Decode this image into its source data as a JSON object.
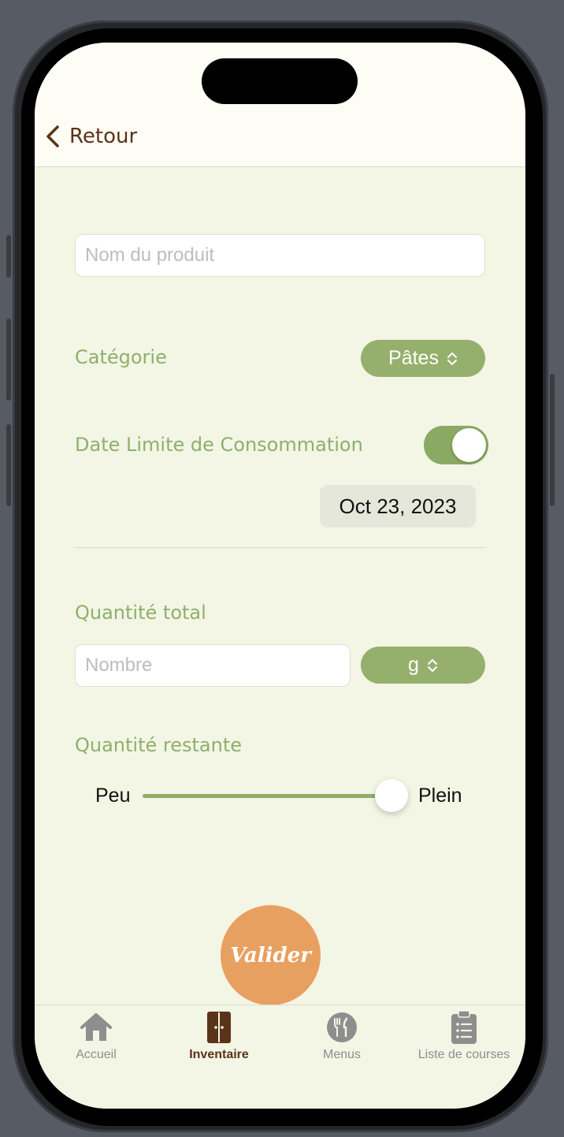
{
  "nav": {
    "back_label": "Retour"
  },
  "form": {
    "product_name_placeholder": "Nom du produit",
    "category_label": "Catégorie",
    "category_value": "Pâtes",
    "expiry_label": "Date Limite de Consommation",
    "expiry_enabled": true,
    "expiry_date": "Oct 23, 2023",
    "total_quantity_label": "Quantité total",
    "number_placeholder": "Nombre",
    "unit_value": "g",
    "remaining_label": "Quantité restante",
    "slider_min_label": "Peu",
    "slider_max_label": "Plein",
    "remaining_fraction": 1.0
  },
  "validate_label": "Valider",
  "tabs": [
    {
      "label": "Accueil",
      "icon": "house-icon",
      "active": false
    },
    {
      "label": "Inventaire",
      "icon": "cupboard-icon",
      "active": true
    },
    {
      "label": "Menus",
      "icon": "fork-knife-icon",
      "active": false
    },
    {
      "label": "Liste de courses",
      "icon": "clipboard-list-icon",
      "active": false
    }
  ],
  "colors": {
    "background": "#f3f5e5",
    "accent_green": "#95b06c",
    "brown": "#5a3319",
    "orange": "#e8a060"
  }
}
